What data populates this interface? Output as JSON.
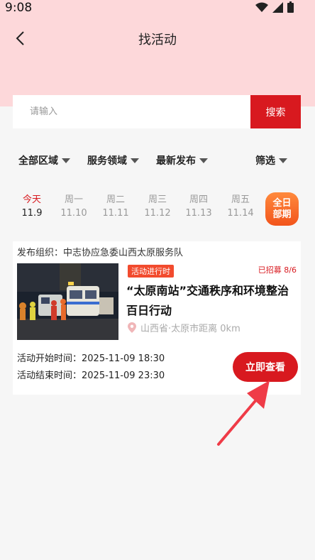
{
  "status": {
    "time": "9:08"
  },
  "nav": {
    "title": "找活动",
    "back_icon": "chevron-left-icon"
  },
  "search": {
    "placeholder": "请输入",
    "button_label": "搜索"
  },
  "filters": [
    "全部区域",
    "服务领域",
    "最新发布",
    "筛选"
  ],
  "dates": [
    {
      "weekday": "今天",
      "date": "11.9",
      "active": true
    },
    {
      "weekday": "周一",
      "date": "11.10"
    },
    {
      "weekday": "周二",
      "date": "11.11"
    },
    {
      "weekday": "周三",
      "date": "11.12"
    },
    {
      "weekday": "周四",
      "date": "11.13"
    },
    {
      "weekday": "周五",
      "date": "11.14"
    }
  ],
  "all_days": {
    "line1": "全日",
    "line2": "部期"
  },
  "activity": {
    "org": "发布组织：中志协应急委山西太原服务队",
    "status_tag": "活动进行时",
    "recruit": "已招募 8/6",
    "title": "“太原南站”交通秩序和环境整治百日行动",
    "location": "山西省·太原市距离 0km",
    "start_time": "活动开始时间：2025-11-09 18:30",
    "end_time": "活动结束时间：2025-11-09 23:30",
    "view_label": "立即查看"
  },
  "colors": {
    "accent": "#d8191f",
    "header_bg": "#fdd8da",
    "orange": "#f2541b"
  }
}
